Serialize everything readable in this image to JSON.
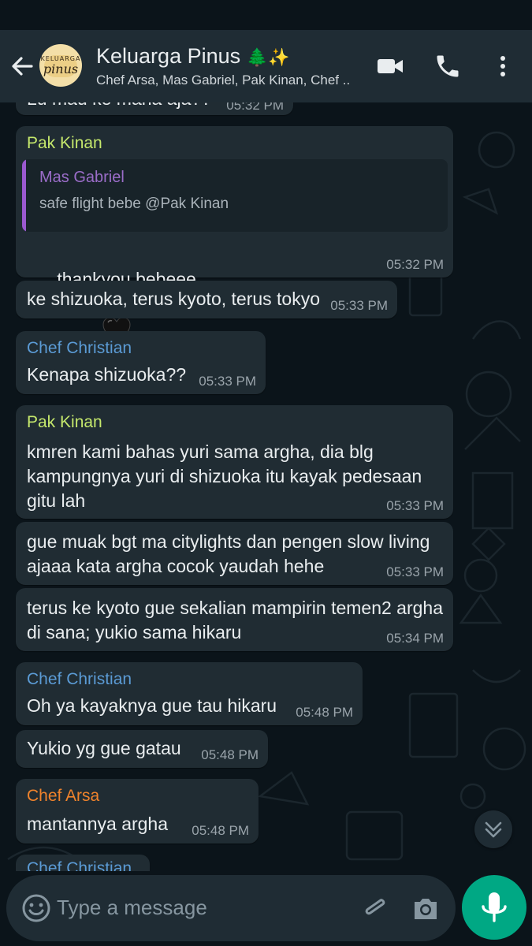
{
  "header": {
    "title": "Keluarga Pinus",
    "title_emoji": "🌲",
    "title_sparkle": "✨",
    "subtitle": "Chef Arsa, Mas Gabriel, Pak Kinan, Chef ..",
    "avatar_text_top": "KELUARGA",
    "avatar_text_bottom": "pinus",
    "icons": [
      "back-arrow-icon",
      "video-call-icon",
      "voice-call-icon",
      "more-options-icon"
    ]
  },
  "colors": {
    "header_bg": "#1f2c34",
    "chat_bg": "#0b141a",
    "bubble_bg": "#202c33",
    "accent": "#00a884",
    "pak_kinan": "#c5e86c",
    "chef_christian": "#5b9bd5",
    "chef_arsa": "#f0832c",
    "mas_gabriel": "#9b6dc9"
  },
  "messages": [
    {
      "text": "Lu mau ke mana aja??",
      "time": "05:32 PM"
    },
    {
      "sender": "Pak Kinan",
      "quote_name": "Mas Gabriel",
      "quote_text": "safe flight bebe @Pak Kinan",
      "text": "thankyou bebeee",
      "emoji": "black-heart",
      "time": "05:32 PM"
    },
    {
      "text": "ke shizuoka, terus kyoto, terus tokyo",
      "time": "05:33 PM"
    },
    {
      "sender": "Chef Christian",
      "text": "Kenapa shizuoka??",
      "time": "05:33 PM"
    },
    {
      "sender": "Pak Kinan",
      "text": "kmren kami bahas yuri sama argha, dia blg\nkampungnya yuri di shizuoka itu kayak pedesaan\ngitu lah",
      "time": "05:33 PM"
    },
    {
      "text": "gue muak bgt ma citylights dan pengen slow living\najaaa kata argha cocok yaudah hehe",
      "time": "05:33 PM"
    },
    {
      "text": "terus ke kyoto gue sekalian mampirin temen2 argha\ndi sana; yukio sama hikaru",
      "time": "05:34 PM"
    },
    {
      "sender": "Chef Christian",
      "text": "Oh ya kayaknya gue tau hikaru",
      "time": "05:48 PM"
    },
    {
      "text": "Yukio yg gue gatau",
      "time": "05:48 PM"
    },
    {
      "sender": "Chef Arsa",
      "text": "mantannya argha",
      "time": "05:48 PM"
    },
    {
      "sender": "Chef Christian"
    }
  ],
  "input": {
    "placeholder": "Type a message",
    "icons": [
      "emoji-icon",
      "attach-icon",
      "camera-icon",
      "mic-icon"
    ]
  }
}
